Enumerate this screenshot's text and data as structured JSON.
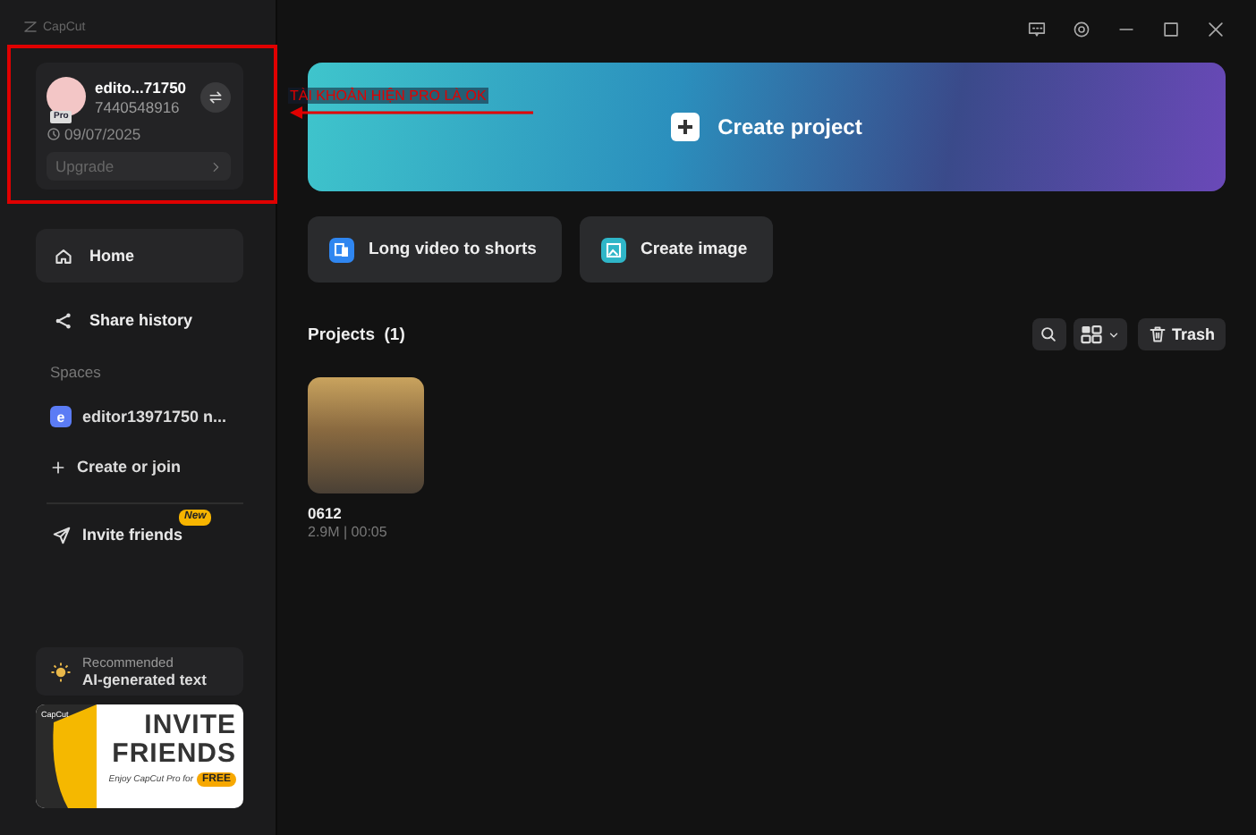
{
  "app": {
    "logo": "CapCut"
  },
  "account": {
    "name": "edito...71750",
    "id": "7440548916",
    "badge": "Pro",
    "date": "09/07/2025",
    "upgrade": "Upgrade"
  },
  "nav": [
    {
      "kind": "home",
      "label": "Home",
      "selected": true
    },
    {
      "kind": "share",
      "label": "Share history",
      "selected": false
    }
  ],
  "spaces": {
    "heading": "Spaces",
    "items": [
      {
        "kind": "space",
        "label": "editor13971750 n...",
        "avatar": "e"
      },
      {
        "kind": "create",
        "label": "Create or join"
      }
    ]
  },
  "invite": {
    "label": "Invite friends",
    "badge": "New"
  },
  "recommended": {
    "caption": "Recommended",
    "title": "AI-generated text"
  },
  "promo_banner": {
    "brand": "CapCut",
    "headline": [
      "INVITE",
      "FRIENDS"
    ],
    "tagline": "Enjoy CapCut Pro for",
    "badge": "FREE"
  },
  "create_project": {
    "label": "Create project"
  },
  "quick_actions": [
    {
      "kind": "shorts",
      "label": "Long video to shorts"
    },
    {
      "kind": "image",
      "label": "Create image"
    }
  ],
  "projects": {
    "title": "Projects",
    "count": "(1)",
    "trash": "Trash",
    "items": [
      {
        "name": "0612",
        "meta": "2.9M | 00:05"
      }
    ]
  },
  "annotation": {
    "text": "TÀI KHOẢN HIỆN PRO LÀ OK"
  }
}
